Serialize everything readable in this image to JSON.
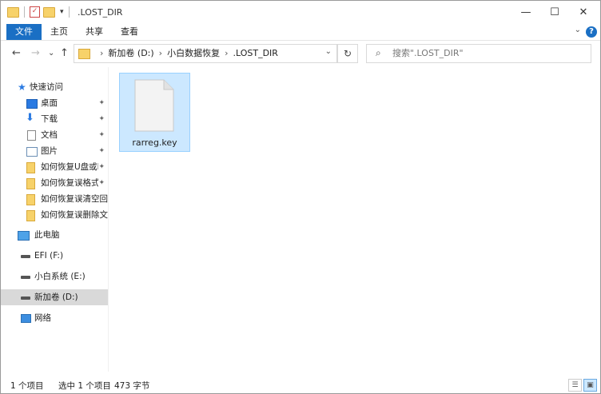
{
  "window": {
    "title": ".LOST_DIR",
    "minimize_glyph": "—",
    "maximize_glyph": "☐",
    "close_glyph": "✕"
  },
  "ribbon": {
    "tabs": [
      "文件",
      "主页",
      "共享",
      "查看"
    ],
    "help_glyph": "?",
    "expand_glyph": "⌄"
  },
  "nav": {
    "back_glyph": "←",
    "forward_glyph": "→",
    "recent_glyph": "⌄",
    "up_glyph": "↑",
    "refresh_glyph": "↻"
  },
  "address": {
    "crumbs": [
      "新加卷 (D:)",
      "小白数据恢复",
      ".LOST_DIR"
    ],
    "separator": "›",
    "dropdown_glyph": "⌄"
  },
  "search": {
    "placeholder": "搜索\".LOST_DIR\"",
    "icon_glyph": "⌕"
  },
  "sidebar": {
    "quick_access": "快速访问",
    "quick_items": [
      {
        "label": "桌面",
        "icon": "desktop-icon",
        "pinned": true
      },
      {
        "label": "下载",
        "icon": "download-icon",
        "pinned": true
      },
      {
        "label": "文档",
        "icon": "document-icon",
        "pinned": true
      },
      {
        "label": "图片",
        "icon": "picture-icon",
        "pinned": true
      },
      {
        "label": "如何恢复U盘或P",
        "icon": "folder-icon",
        "pinned": true
      },
      {
        "label": "如何恢复误格式(",
        "icon": "folder-icon",
        "pinned": true
      },
      {
        "label": "如何恢复误清空回收",
        "icon": "folder-icon",
        "pinned": false
      },
      {
        "label": "如何恢复误删除文件",
        "icon": "folder-icon",
        "pinned": false
      }
    ],
    "this_pc": "此电脑",
    "drives": [
      {
        "label": "EFI (F:)",
        "selected": false
      },
      {
        "label": "小白系统 (E:)",
        "selected": false
      },
      {
        "label": "新加卷 (D:)",
        "selected": true
      }
    ],
    "network": "网络",
    "pin_glyph": "📌"
  },
  "files": [
    {
      "name": "rarreg.key",
      "selected": true
    }
  ],
  "status": {
    "item_count": "1 个项目",
    "selected": "选中 1 个项目",
    "size": "473 字节"
  },
  "colors": {
    "accent": "#1a6fc4",
    "selection": "#cce8ff",
    "folder": "#f7d26a"
  }
}
